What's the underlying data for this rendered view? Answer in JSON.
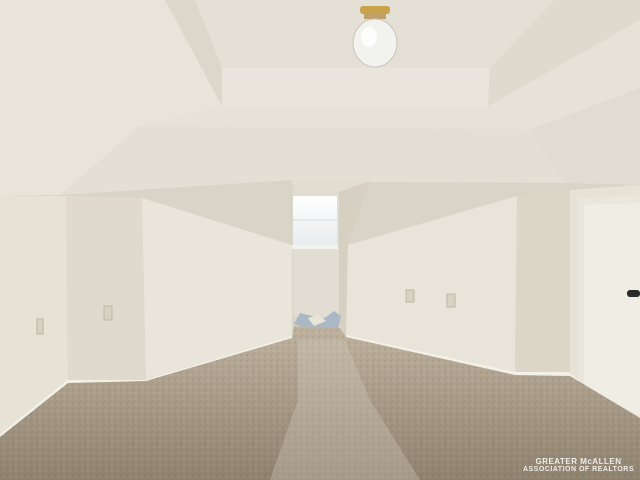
{
  "scene": {
    "description_free": true,
    "colors": {
      "ceiling": "#e6e2d8",
      "ceiling_shadow": "#d4cfc3",
      "wall_light": "#ebe7dc",
      "wall_mid": "#ddd8cb",
      "wall_dark": "#cfc9bb",
      "floor": "#a89a85",
      "floor_dark": "#8c7f6c",
      "baseboard": "#f1eee6",
      "window_glow": "#ffffff",
      "door": "#f0ede4",
      "door_knob": "#2a2a2a"
    },
    "icons": [
      "ceiling-light-icon",
      "door-knob-icon"
    ]
  },
  "watermark": {
    "brand": "GREATER McALLEN",
    "sub": "ASSOCIATION OF REALTORS"
  }
}
